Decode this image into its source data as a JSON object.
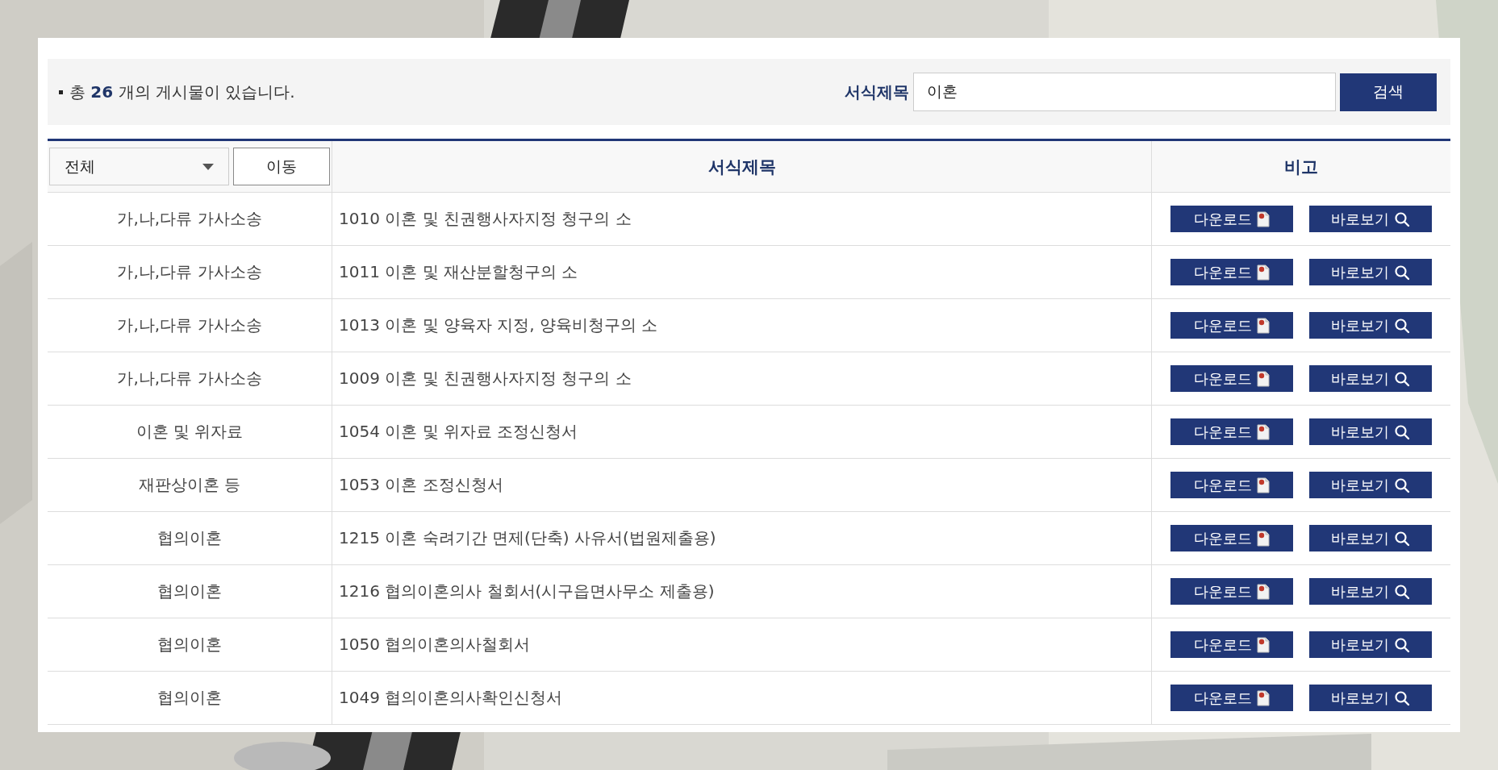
{
  "summary": {
    "text": "총 **26** 개의 게시물이 있습니다."
  },
  "search": {
    "label": "서식제목",
    "value": "이혼",
    "button": "검색"
  },
  "table": {
    "category_select": {
      "value": "전체"
    },
    "move_button": "이동",
    "columns": [
      "서식제목",
      "비고"
    ],
    "rows": [
      {
        "category": "가,나,다류 가사소송",
        "title": "1010 이혼 및 친권행사자지정 청구의 소",
        "download": "다운로드",
        "view": "바로보기"
      },
      {
        "category": "가,나,다류 가사소송",
        "title": "1011 이혼 및 재산분할청구의 소",
        "download": "다운로드",
        "view": "바로보기"
      },
      {
        "category": "가,나,다류 가사소송",
        "title": "1013 이혼 및 양육자 지정, 양육비청구의 소",
        "download": "다운로드",
        "view": "바로보기"
      },
      {
        "category": "가,나,다류 가사소송",
        "title": "1009 이혼 및 친권행사자지정 청구의 소",
        "download": "다운로드",
        "view": "바로보기"
      },
      {
        "category": "이혼 및 위자료",
        "title": "1054 이혼 및 위자료 조정신청서",
        "download": "다운로드",
        "view": "바로보기"
      },
      {
        "category": "재판상이혼 등",
        "title": "1053 이혼 조정신청서",
        "download": "다운로드",
        "view": "바로보기"
      },
      {
        "category": "협의이혼",
        "title": "1215 이혼 숙려기간 면제(단축) 사유서(법원제출용)",
        "download": "다운로드",
        "view": "바로보기"
      },
      {
        "category": "협의이혼",
        "title": "1216 협의이혼의사 철회서(시구읍면사무소 제출용)",
        "download": "다운로드",
        "view": "바로보기"
      },
      {
        "category": "협의이혼",
        "title": "1050 협의이혼의사철회서",
        "download": "다운로드",
        "view": "바로보기"
      },
      {
        "category": "협의이혼",
        "title": "1049 협의이혼의사확인신청서",
        "download": "다운로드",
        "view": "바로보기"
      }
    ]
  }
}
